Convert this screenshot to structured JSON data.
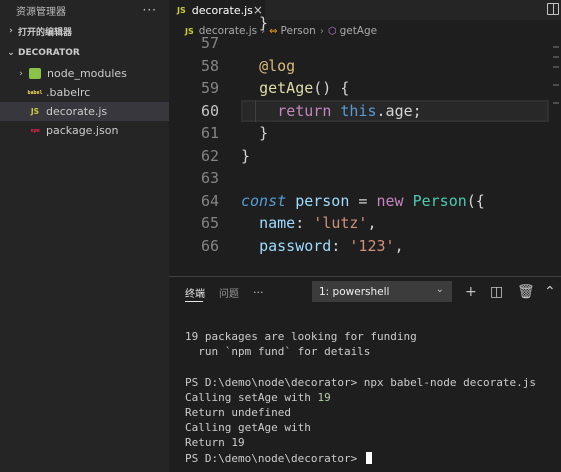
{
  "sidebar": {
    "title": "资源管理器",
    "more": "···",
    "open_editors": "打开的编辑器",
    "folder": "DECORATOR",
    "items": [
      {
        "label": "node_modules",
        "icon": "node-folder-icon"
      },
      {
        "label": ".babelrc",
        "icon": "babel-icon",
        "icon_text": "babel"
      },
      {
        "label": "decorate.js",
        "icon": "js-icon",
        "icon_text": "JS"
      },
      {
        "label": "package.json",
        "icon": "npm-icon",
        "icon_text": "npm"
      }
    ]
  },
  "editor": {
    "tab": {
      "icon_text": "JS",
      "label": "decorate.js",
      "close": "×"
    },
    "breadcrumb": {
      "icon_text": "JS",
      "file": "decorate.js",
      "class_name": "Person",
      "method": "getAge"
    },
    "lines": [
      {
        "n": "57",
        "tokens": []
      },
      {
        "n": "58",
        "tokens": [
          {
            "t": "@log",
            "c": "deco"
          }
        ]
      },
      {
        "n": "59",
        "tokens": [
          {
            "t": "getAge",
            "c": "fn"
          },
          {
            "t": "() {",
            "c": "plain"
          }
        ]
      },
      {
        "n": "60",
        "tokens": [
          {
            "t": "return",
            "c": "kw"
          },
          {
            "t": " ",
            "c": "plain"
          },
          {
            "t": "this",
            "c": "this"
          },
          {
            "t": ".age;",
            "c": "plain"
          }
        ]
      },
      {
        "n": "61",
        "tokens": [
          {
            "t": "}",
            "c": "plain"
          }
        ]
      },
      {
        "n": "62",
        "tokens": [
          {
            "t": "}",
            "c": "plain"
          }
        ]
      },
      {
        "n": "63",
        "tokens": []
      },
      {
        "n": "64",
        "tokens": [
          {
            "t": "const",
            "c": "const"
          },
          {
            "t": " ",
            "c": "plain"
          },
          {
            "t": "person",
            "c": "var"
          },
          {
            "t": " = ",
            "c": "plain"
          },
          {
            "t": "new",
            "c": "kw"
          },
          {
            "t": " ",
            "c": "plain"
          },
          {
            "t": "Person",
            "c": "cls"
          },
          {
            "t": "({",
            "c": "plain"
          }
        ]
      },
      {
        "n": "65",
        "tokens": [
          {
            "t": "name",
            "c": "var"
          },
          {
            "t": ": ",
            "c": "plain"
          },
          {
            "t": "'lutz'",
            "c": "str"
          },
          {
            "t": ",",
            "c": "plain"
          }
        ]
      },
      {
        "n": "66",
        "tokens": [
          {
            "t": "password",
            "c": "var"
          },
          {
            "t": ": ",
            "c": "plain"
          },
          {
            "t": "'123'",
            "c": "str"
          },
          {
            "t": ",",
            "c": "plain"
          }
        ]
      }
    ]
  },
  "panel": {
    "tabs": [
      "终端",
      "问题"
    ],
    "more": "···",
    "terminal_select": "1: powershell",
    "terminal_lines": [
      "19 packages are looking for funding",
      "  run `npm fund` for details",
      "",
      "PS D:\\demo\\node\\decorator> npx babel-node decorate.js",
      "Calling setAge with 19",
      "Return undefined",
      "Calling getAge with",
      "Return 19",
      "PS D:\\demo\\node\\decorator> "
    ]
  }
}
